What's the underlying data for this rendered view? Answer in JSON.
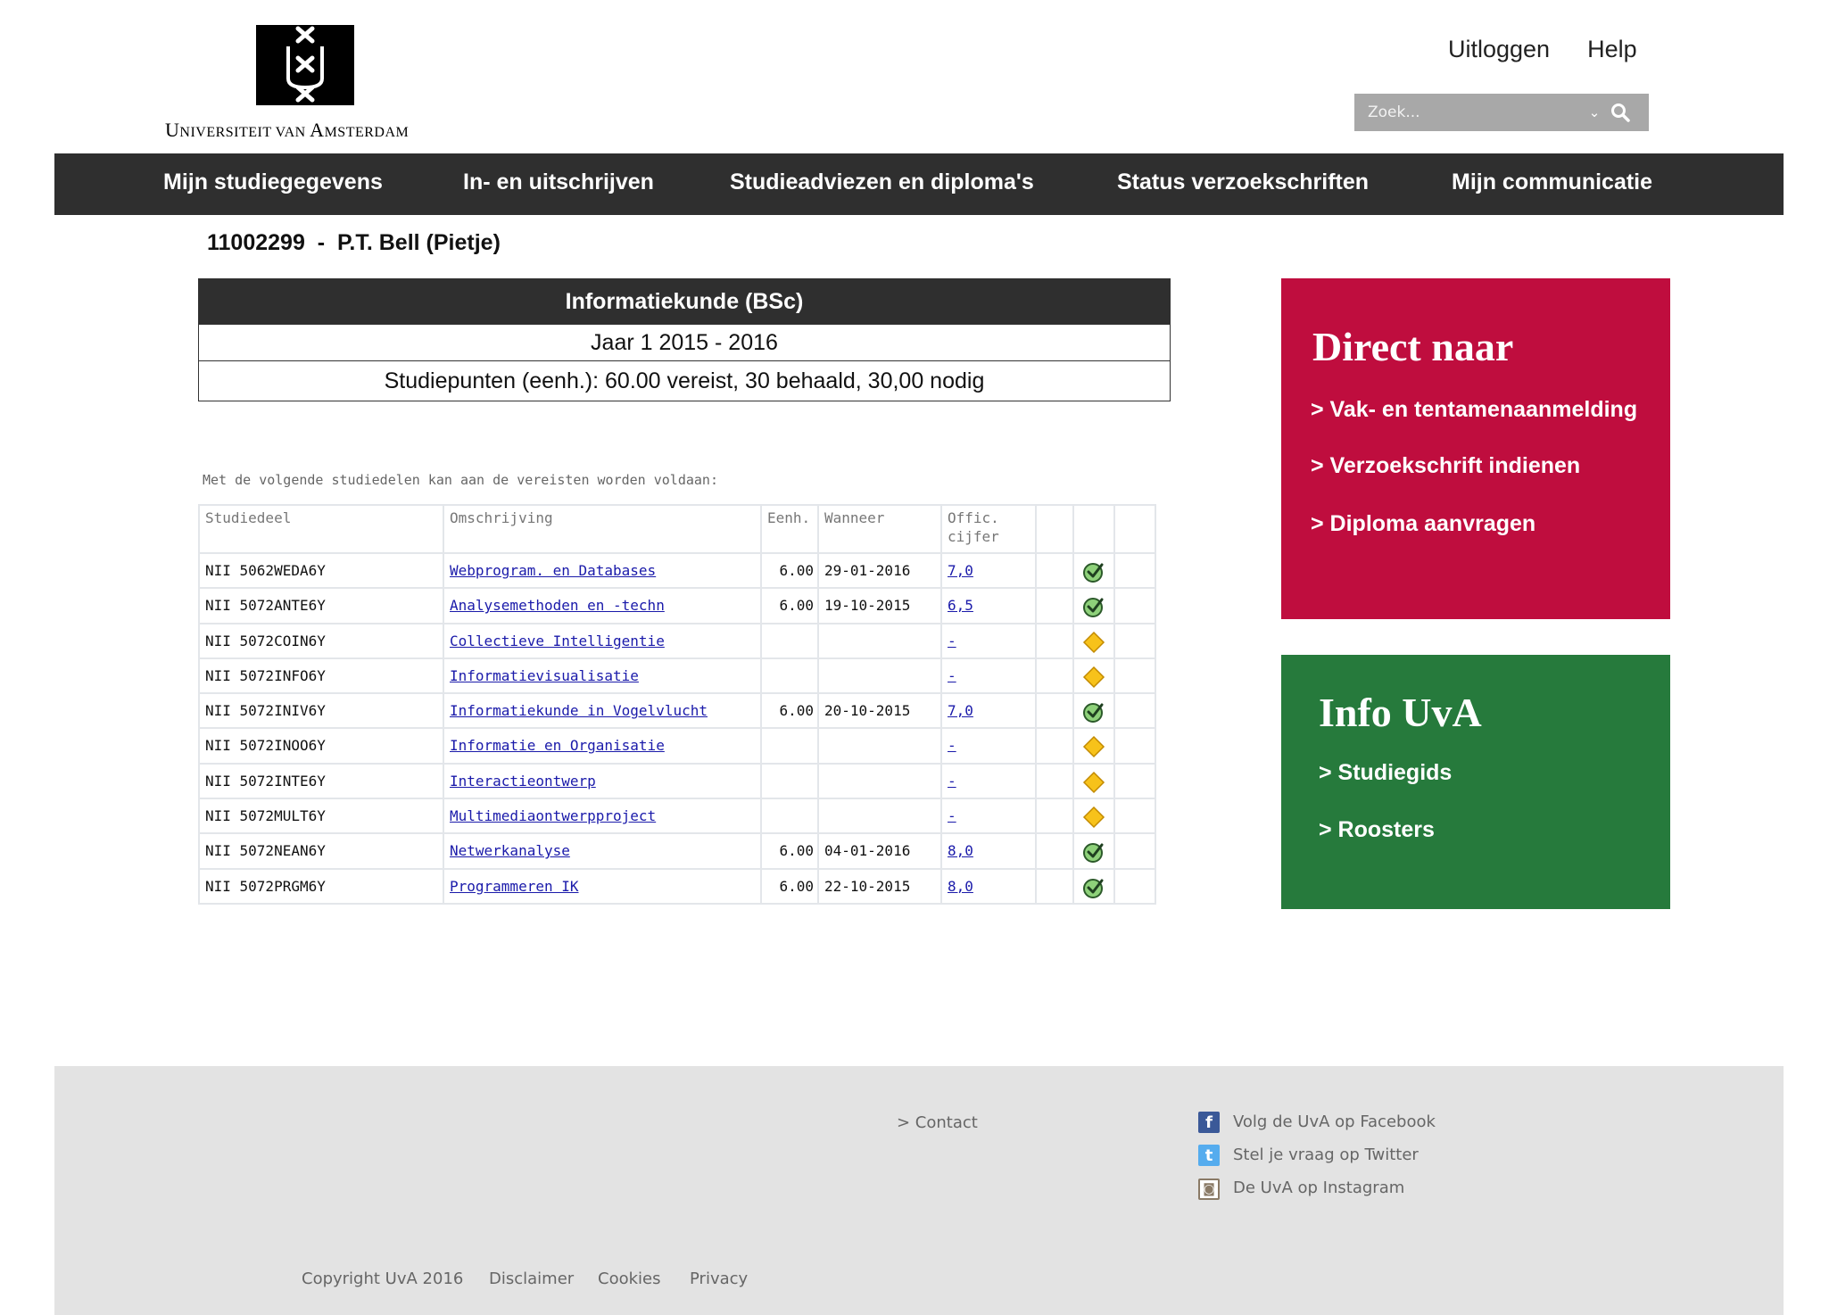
{
  "header": {
    "logo_crosses": "✕✕✕",
    "university_name": "Universiteit van Amsterdam",
    "university_parts": [
      "U",
      "NIVERSITEIT VAN ",
      "A",
      "MSTERDAM"
    ],
    "logout_label": "Uitloggen",
    "help_label": "Help",
    "search": {
      "placeholder": "Zoek...",
      "icon": "search-icon"
    }
  },
  "nav": {
    "items": [
      {
        "label": "Mijn studiegegevens"
      },
      {
        "label": "In- en uitschrijven"
      },
      {
        "label": "Studieadviezen en diploma's"
      },
      {
        "label": "Status verzoekschriften"
      },
      {
        "label": "Mijn communicatie"
      }
    ]
  },
  "student": {
    "line": "11002299  -  P.T. Bell (Pietje)"
  },
  "program": {
    "title": "Informatiekunde (BSc)",
    "year": "Jaar 1 2015 - 2016",
    "credits": "Studiepunten (eenh.): 60.00 vereist, 30 behaald, 30,00 nodig"
  },
  "courses": {
    "intro": "Met de volgende studiedelen kan aan de vereisten worden voldaan:",
    "headers": {
      "code": "Studiedeel",
      "description": "Omschrijving",
      "units": "Eenh.",
      "when": "Wanneer",
      "grade_line1": "Offic.",
      "grade_line2": "cijfer"
    },
    "rows": [
      {
        "code": "NII 5062WEDA6Y",
        "description": "Webprogram. en Databases",
        "units": "6.00",
        "date": "29-01-2016",
        "grade": "7,0",
        "status": "passed"
      },
      {
        "code": "NII 5072ANTE6Y",
        "description": "Analysemethoden en -techn",
        "units": "6.00",
        "date": "19-10-2015",
        "grade": "6,5",
        "status": "passed"
      },
      {
        "code": "NII 5072COIN6Y",
        "description": "Collectieve Intelligentie",
        "units": "",
        "date": "",
        "grade": "-",
        "status": "pending"
      },
      {
        "code": "NII 5072INFO6Y",
        "description": "Informatievisualisatie",
        "units": "",
        "date": "",
        "grade": "-",
        "status": "pending"
      },
      {
        "code": "NII 5072INIV6Y",
        "description": "Informatiekunde in Vogelvlucht",
        "units": "6.00",
        "date": "20-10-2015",
        "grade": "7,0",
        "status": "passed"
      },
      {
        "code": "NII 5072INOO6Y",
        "description": "Informatie en Organisatie",
        "units": "",
        "date": "",
        "grade": "-",
        "status": "pending"
      },
      {
        "code": "NII 5072INTE6Y",
        "description": "Interactieontwerp",
        "units": "",
        "date": "",
        "grade": "-",
        "status": "pending"
      },
      {
        "code": "NII 5072MULT6Y",
        "description": "Multimediaontwerpproject",
        "units": "",
        "date": "",
        "grade": "-",
        "status": "pending"
      },
      {
        "code": "NII 5072NEAN6Y",
        "description": "Netwerkanalyse",
        "units": "6.00",
        "date": "04-01-2016",
        "grade": "8,0",
        "status": "passed"
      },
      {
        "code": "NII 5072PRGM6Y",
        "description": "Programmeren IK",
        "units": "6.00",
        "date": "22-10-2015",
        "grade": "8,0",
        "status": "passed"
      }
    ]
  },
  "direct_panel": {
    "title": "Direct naar",
    "links": [
      {
        "label": "> Vak- en tentamenaanmelding"
      },
      {
        "label": "> Verzoekschrift indienen"
      },
      {
        "label": "> Diploma aanvragen"
      }
    ],
    "color": "#bf0d3e"
  },
  "info_panel": {
    "title": "Info UvA",
    "links": [
      {
        "label": "> Studiegids"
      },
      {
        "label": "> Roosters"
      }
    ],
    "color": "#267a3c"
  },
  "footer": {
    "contact": "> Contact",
    "social": [
      {
        "icon": "facebook-icon",
        "glyph": "f",
        "label": "Volg de UvA op Facebook",
        "color": "#3b5998"
      },
      {
        "icon": "twitter-icon",
        "glyph": "t",
        "label": "Stel je vraag op Twitter",
        "color": "#55acee"
      },
      {
        "icon": "instagram-icon",
        "glyph": "◙",
        "label": "De UvA op Instagram",
        "color": "#8a7a66"
      }
    ],
    "bottom_links": [
      {
        "label": "Copyright UvA 2016"
      },
      {
        "label": "Disclaimer"
      },
      {
        "label": "Cookies"
      },
      {
        "label": "Privacy"
      }
    ]
  }
}
